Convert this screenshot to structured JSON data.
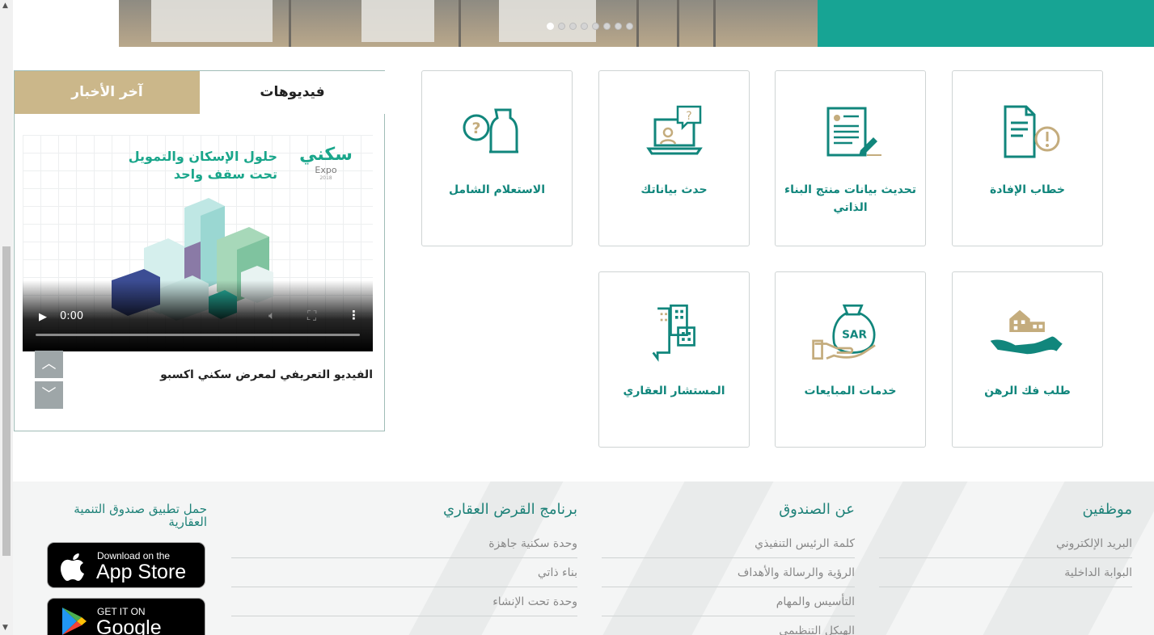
{
  "colors": {
    "teal": "#17a494",
    "sand": "#cbb78a",
    "label": "#11867c"
  },
  "carousel": {
    "dot_count": 8,
    "active_index": 0
  },
  "services": [
    {
      "label": "خطاب الإفادة",
      "icon": "letter-exclamation-icon"
    },
    {
      "label": "تحديث بيانات منتج البناء الذاتي",
      "icon": "document-edit-icon"
    },
    {
      "label": "حدث بياناتك",
      "icon": "laptop-question-icon"
    },
    {
      "label": "الاستعلام الشامل",
      "icon": "inquiry-question-icon"
    },
    {
      "label": "طلب فك الرهن",
      "icon": "house-in-hand-icon"
    },
    {
      "label": "خدمات المبايعات",
      "icon": "sar-money-bag-icon"
    },
    {
      "label": "المستشار العقاري",
      "icon": "building-chat-icon"
    }
  ],
  "media": {
    "tabs": {
      "videos": "فيديوهات",
      "news": "آخر الأخبار"
    },
    "video": {
      "title_line1": "حلول الإسكان والتمويل",
      "title_line2": "تحت سقف واحد",
      "brand": "سكني",
      "brand_sub": "Expo",
      "brand_year": "2018",
      "time": "0:00"
    },
    "caption": "الفيديو التعريفي لمعرض سكني اكسبو"
  },
  "footer": {
    "columns": [
      {
        "title": "موظفين",
        "links": [
          "البريد الإلكتروني",
          "البوابة الداخلية"
        ]
      },
      {
        "title": "عن الصندوق",
        "links": [
          "كلمة الرئيس التنفيذي",
          "الرؤية والرسالة والأهداف",
          "التأسيس والمهام",
          "الهيكل التنظيمي"
        ]
      },
      {
        "title": "برنامج القرض العقاري",
        "links": [
          "وحدة سكنية جاهزة",
          "بناء ذاتي",
          "وحدة تحت الإنشاء"
        ]
      }
    ],
    "app_label": "حمل تطبيق صندوق التنمية العقارية",
    "appstore": {
      "small": "Download on the",
      "big": "App Store"
    },
    "googleplay": {
      "small": "GET IT ON",
      "big": "Google Play"
    }
  }
}
